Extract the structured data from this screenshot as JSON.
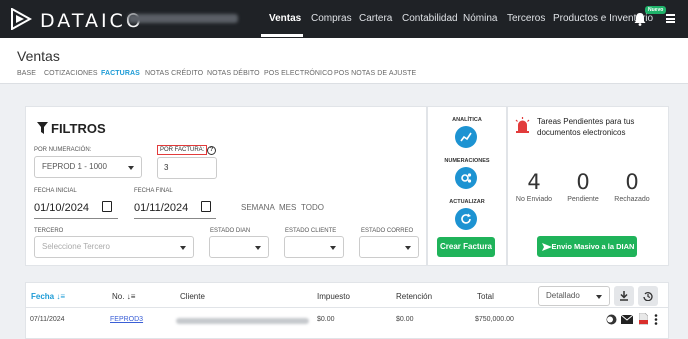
{
  "topbar": {
    "brand": "DATAICO",
    "nav": [
      "Ventas",
      "Compras",
      "Cartera",
      "Contabilidad",
      "Nómina",
      "Terceros",
      "Productos e Inventario"
    ],
    "badge": "Nuevo"
  },
  "header": {
    "title": "Ventas",
    "tabs": [
      "BASE",
      "COTIZACIONES",
      "FACTURAS",
      "NOTAS CRÉDITO",
      "NOTAS DÉBITO",
      "POS ELECTRÓNICO",
      "POS NOTAS DE AJUSTE"
    ],
    "active_tab": "FACTURAS"
  },
  "filters": {
    "title": "FILTROS",
    "numeracion_label": "POR NUMERACIÓN:",
    "numeracion_value": "FEPROD 1 - 1000",
    "factura_label": "POR FACTURA:",
    "factura_help": "?",
    "factura_value": "3",
    "fecha_inicial_label": "FECHA INICIAL",
    "fecha_inicial_value": "01/10/2024",
    "fecha_final_label": "FECHA FINAL",
    "fecha_final_value": "01/11/2024",
    "periods": [
      "SEMANA",
      "MES",
      "TODO"
    ],
    "tercero_label": "TERCERO",
    "tercero_placeholder": "Seleccione Tercero",
    "estado_dian_label": "ESTADO DIAN",
    "estado_cliente_label": "ESTADO CLIENTE",
    "estado_correo_label": "ESTADO CORREO"
  },
  "actions": {
    "analitica_label": "ANALÍTICA",
    "numeraciones_label": "NUMERACIONES",
    "actualizar_label": "ACTUALIZAR",
    "crear_factura": "Crear Factura"
  },
  "tareas": {
    "title": "Tareas Pendientes para tus documentos electronicos",
    "counts": [
      {
        "value": "4",
        "label": "No Enviado"
      },
      {
        "value": "0",
        "label": "Pendiente"
      },
      {
        "value": "0",
        "label": "Rechazado"
      }
    ],
    "envio_masivo": "Envio Masivo a la DIAN"
  },
  "table": {
    "headers": [
      "Fecha",
      "No.",
      "Cliente",
      "Impuesto",
      "Retención",
      "Total"
    ],
    "view_select": "Detallado",
    "rows": [
      {
        "fecha": "07/11/2024",
        "numero": "FEPROD3",
        "impuesto": "$0.00",
        "retencion": "$0.00",
        "total": "$750,000.00"
      }
    ]
  },
  "colors": {
    "topbar": "#1f2226",
    "accent_blue": "#1d93d2",
    "green": "#1fb35a",
    "red_outline": "#e23b3b"
  }
}
